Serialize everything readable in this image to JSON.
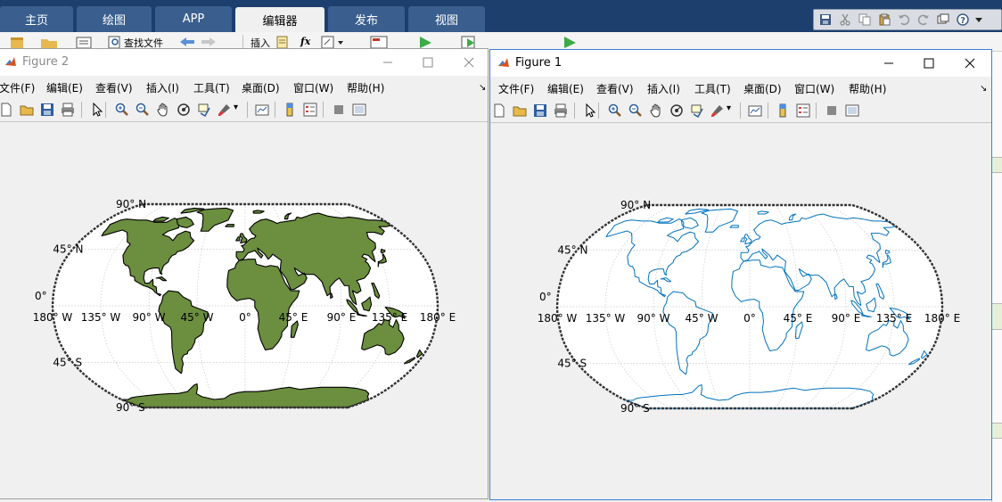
{
  "desktop": {
    "tabs": [
      {
        "label": "主页"
      },
      {
        "label": "绘图"
      },
      {
        "label": "APP"
      },
      {
        "label": "编辑器"
      },
      {
        "label": "发布"
      },
      {
        "label": "视图"
      }
    ],
    "ribbon": {
      "find_files": "查找文件",
      "insert": "插入",
      "fx": "fx"
    },
    "colors": {
      "tabbar": "#1c3f6e",
      "tab": "#3a5f8f",
      "active_tab": "#f0f0f0"
    }
  },
  "figures": [
    {
      "title": "Figure 2",
      "menu": [
        "文件(F)",
        "编辑(E)",
        "查看(V)",
        "插入(I)",
        "工具(T)",
        "桌面(D)",
        "窗口(W)",
        "帮助(H)"
      ],
      "map_style": "filled",
      "land_color": "#6b8e3f",
      "coast_color": "#000000"
    },
    {
      "title": "Figure 1",
      "menu": [
        "文件(F)",
        "编辑(E)",
        "查看(V)",
        "插入(I)",
        "工具(T)",
        "桌面(D)",
        "窗口(W)",
        "帮助(H)"
      ],
      "map_style": "outline",
      "land_color": "none",
      "coast_color": "#0072bd"
    }
  ],
  "map_labels": {
    "lat": [
      "90° N",
      "45° N",
      "0°",
      "45° S",
      "90° S"
    ],
    "lon": [
      "180° W",
      "135° W",
      "90° W",
      "45° W",
      "0°",
      "45° E",
      "90° E",
      "135° E",
      "180° E"
    ]
  },
  "toolbar_icons": [
    "new-file-icon",
    "open-folder-icon",
    "save-icon",
    "print-icon",
    "pointer-icon",
    "zoom-in-icon",
    "zoom-out-icon",
    "pan-hand-icon",
    "rotate-3d-icon",
    "data-cursor-icon",
    "brush-icon",
    "link-plot-icon",
    "colorbar-icon",
    "legend-icon",
    "hide-plot-tools-icon",
    "show-plot-tools-icon"
  ]
}
